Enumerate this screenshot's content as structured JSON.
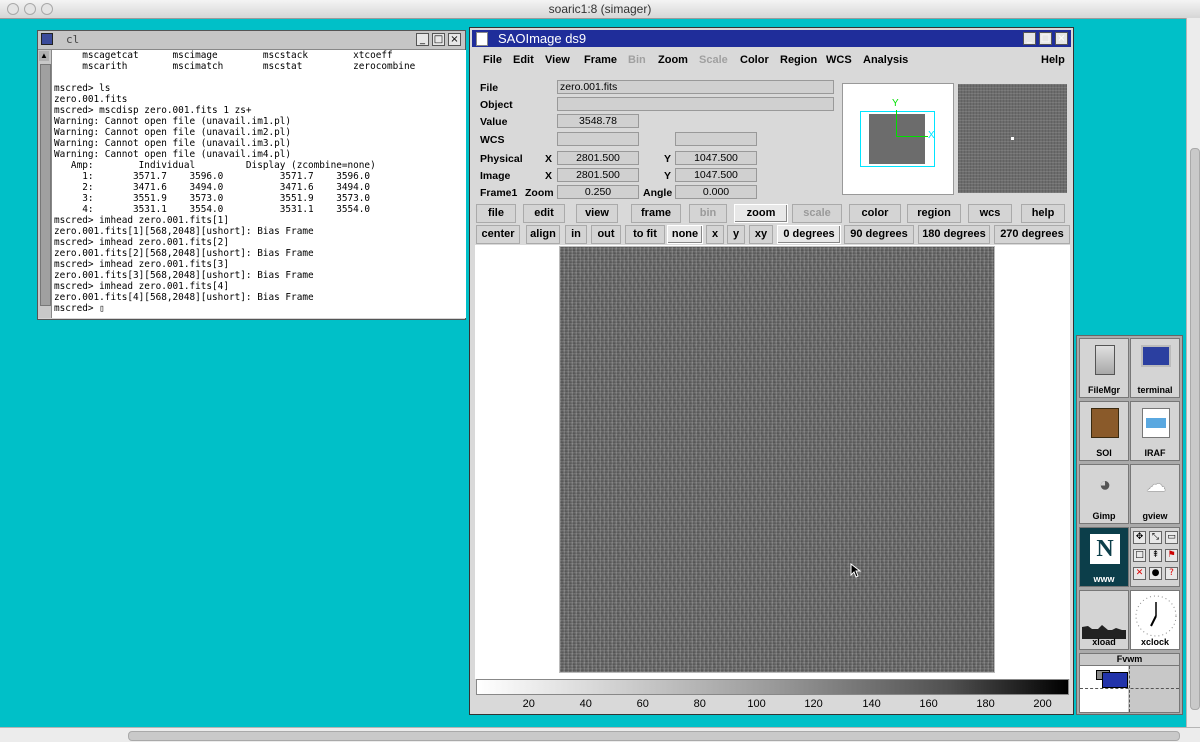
{
  "mac": {
    "title": "soaric1:8 (simager)"
  },
  "xterm": {
    "title": "cl",
    "lines": [
      "     mscagetcat      mscimage        mscstack        xtcoeff",
      "     mscarith        mscimatch       mscstat         zerocombine",
      "",
      "mscred> ls",
      "zero.001.fits",
      "mscred> mscdisp zero.001.fits 1 zs+",
      "Warning: Cannot open file (unavail.im1.pl)",
      "Warning: Cannot open file (unavail.im2.pl)",
      "Warning: Cannot open file (unavail.im3.pl)",
      "Warning: Cannot open file (unavail.im4.pl)",
      "   Amp:        Individual         Display (zcombine=none)",
      "     1:       3571.7    3596.0          3571.7    3596.0",
      "     2:       3471.6    3494.0          3471.6    3494.0",
      "     3:       3551.9    3573.0          3551.9    3573.0",
      "     4:       3531.1    3554.0          3531.1    3554.0",
      "mscred> imhead zero.001.fits[1]",
      "zero.001.fits[1][568,2048][ushort]: Bias Frame",
      "mscred> imhead zero.001.fits[2]",
      "zero.001.fits[2][568,2048][ushort]: Bias Frame",
      "mscred> imhead zero.001.fits[3]",
      "zero.001.fits[3][568,2048][ushort]: Bias Frame",
      "mscred> imhead zero.001.fits[4]",
      "zero.001.fits[4][568,2048][ushort]: Bias Frame",
      "mscred> ▯"
    ]
  },
  "ds9": {
    "title": "SAOImage ds9",
    "menu": [
      "File",
      "Edit",
      "View",
      "Frame",
      "Bin",
      "Zoom",
      "Scale",
      "Color",
      "Region",
      "WCS",
      "Analysis",
      "Help"
    ],
    "info": {
      "file_label": "File",
      "file_value": "zero.001.fits",
      "object_label": "Object",
      "object_value": "",
      "value_label": "Value",
      "value_value": "3548.78",
      "wcs_label": "WCS",
      "physical_label": "Physical",
      "physical_x": "2801.500",
      "physical_y": "1047.500",
      "image_label": "Image",
      "image_x": "2801.500",
      "image_y": "1047.500",
      "frame_label": "Frame1",
      "zoom_label": "Zoom",
      "zoom_value": "0.250",
      "angle_label": "Angle",
      "angle_value": "0.000",
      "x_label": "X",
      "y_label": "Y"
    },
    "buttons_main": [
      "file",
      "edit",
      "view",
      "frame",
      "bin",
      "zoom",
      "scale",
      "color",
      "region",
      "wcs",
      "help"
    ],
    "buttons_zoom": [
      "center",
      "align",
      "in",
      "out",
      "to fit",
      "none",
      "x",
      "y",
      "xy",
      "0 degrees",
      "90 degrees",
      "180 degrees",
      "270 degrees"
    ],
    "panner": {
      "x_label": "X",
      "y_label": "Y"
    },
    "colorbar_ticks": [
      "20",
      "40",
      "60",
      "80",
      "100",
      "120",
      "140",
      "160",
      "180",
      "200"
    ]
  },
  "dock": {
    "items": [
      "FileMgr",
      "terminal",
      "SOI",
      "IRAF",
      "Gimp",
      "gview",
      "www",
      "xload",
      "xclock"
    ],
    "fvwm_label": "Fvwm"
  },
  "colors": {
    "desktop": "#00c0c8",
    "ds9_title": "#1f2d9a",
    "panner_box": "#00e5ff",
    "panner_axes": "#00e000"
  }
}
